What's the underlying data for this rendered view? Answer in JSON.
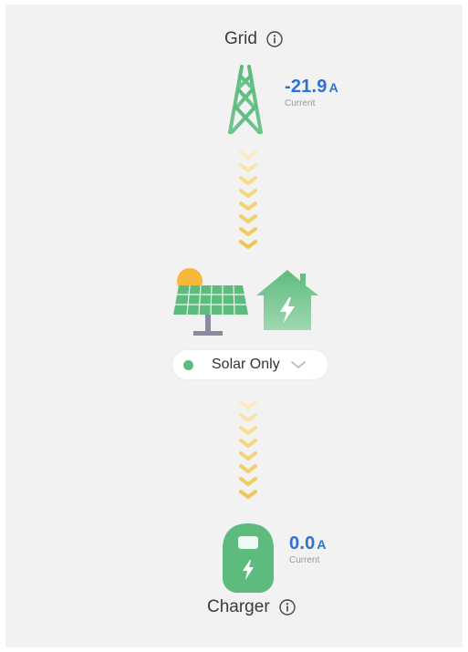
{
  "grid": {
    "title": "Grid",
    "value": "-21.9",
    "unit": "A",
    "sub_label": "Current"
  },
  "mode_selector": {
    "label": "Solar Only",
    "status_color": "#5dbb7e"
  },
  "charger": {
    "title": "Charger",
    "value": "0.0",
    "unit": "A",
    "sub_label": "Current"
  },
  "colors": {
    "accent_green": "#5dbb7e",
    "value_blue": "#2f6fd6",
    "flow_yellow": "#f3d374",
    "sun_orange": "#f6b73c"
  },
  "icons": [
    "info-icon",
    "transmission-tower-icon",
    "flow-chevrons-icon",
    "solar-panel-icon",
    "sun-icon",
    "house-icon",
    "lightning-icon",
    "chevron-down-icon",
    "ev-charger-icon"
  ]
}
